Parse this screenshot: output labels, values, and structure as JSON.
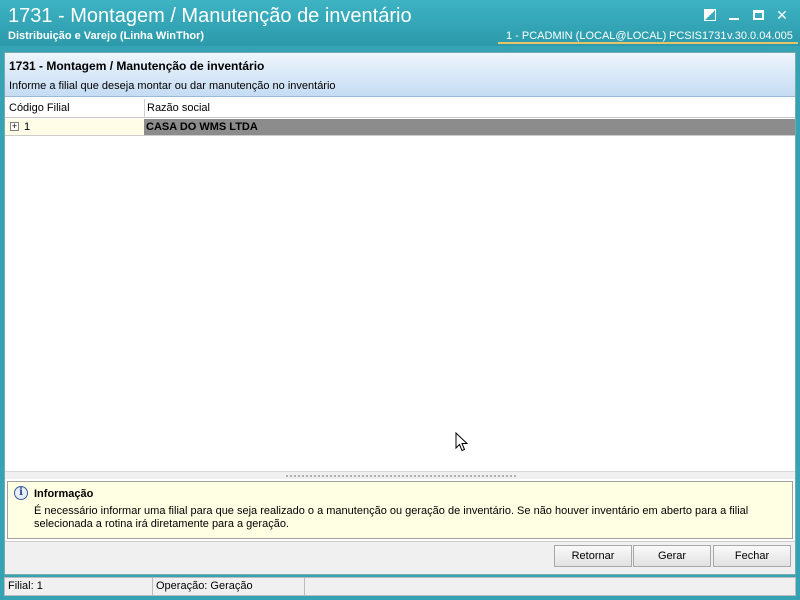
{
  "window": {
    "title": "1731 - Montagem / Manutenção de inventário",
    "subtitle": "Distribuição e Varejo (Linha WinThor)",
    "session_user": "1 - PCADMIN (LOCAL@LOCAL)",
    "session_program": "PCSIS1731",
    "session_version": "v.30.0.04.005"
  },
  "header": {
    "title": "1731 - Montagem / Manutenção de inventário",
    "description": "Informe a filial que deseja montar ou dar manutenção no inventário"
  },
  "grid": {
    "columns": [
      "Código Filial",
      "Razão social"
    ],
    "rows": [
      {
        "codigo": "1",
        "razao": "CASA DO WMS LTDA",
        "expander": "+"
      }
    ]
  },
  "info": {
    "title": "Informação",
    "text": "É necessário informar uma filial para que seja realizado o a manutenção ou geração de inventário. Se não houver inventário em aberto para a filial selecionada a rotina irá diretamente para a geração."
  },
  "buttons": {
    "retornar": "Retornar",
    "gerar": "Gerar",
    "fechar": "Fechar"
  },
  "status": {
    "filial": "Filial: 1",
    "operacao": "Operação: Geração"
  },
  "colors": {
    "titlebar": "#35a3b3",
    "header_gradient_end": "#c5dcf3",
    "selected_row": "#8c8c8c",
    "info_bg": "#ffffe4"
  }
}
